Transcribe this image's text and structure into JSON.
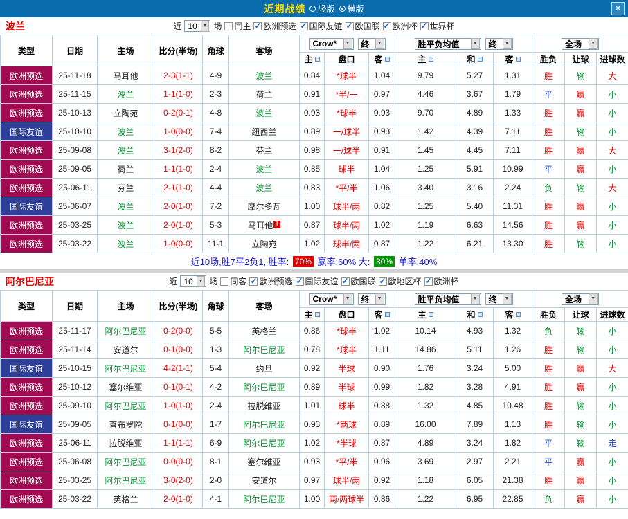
{
  "titlebar": {
    "title": "近期战绩",
    "radios": [
      {
        "label": "竖版",
        "selected": false
      },
      {
        "label": "横版",
        "selected": true
      }
    ]
  },
  "icons": {
    "close": "✕",
    "dropdown_arrow": "▼",
    "checkbox_check": "✓"
  },
  "colors": {
    "titlebar_bg": "#0A6BAD",
    "title_text": "#FFDD00",
    "type_european": "#A00A50",
    "type_friendly": "#2D3F99",
    "team_green": "#009933",
    "score_red": "#E60000",
    "handicap_red": "#E60000",
    "res_win": "#E60000",
    "res_draw": "#2244CC",
    "res_lose": "#009933",
    "badge_red": "#E10000",
    "badge_green": "#089408",
    "summary_text": "#1515CF",
    "grid_border": "#B9CEE2"
  },
  "table_header": {
    "cols": [
      "类型",
      "日期",
      "主场",
      "比分(半场)",
      "角球",
      "客场"
    ],
    "odds_group": {
      "bookmaker": "Crow*",
      "stage": "终"
    },
    "mean_group": {
      "label": "胜平负均值",
      "stage": "终"
    },
    "scope_group": {
      "label": "全场"
    },
    "sub": [
      "主",
      "盘口",
      "客",
      "主",
      "和",
      "客",
      "胜负",
      "让球",
      "进球数"
    ]
  },
  "sections": [
    {
      "team": "波兰",
      "filter": {
        "near": "近",
        "count": "10",
        "games": "场",
        "checks": [
          {
            "label": "同主",
            "checked": false
          },
          {
            "label": "欧洲预选",
            "checked": true
          },
          {
            "label": "国际友谊",
            "checked": true
          },
          {
            "label": "欧国联",
            "checked": true
          },
          {
            "label": "欧洲杯",
            "checked": true
          },
          {
            "label": "世界杯",
            "checked": true
          }
        ]
      },
      "rows": [
        {
          "type": "欧洲预选",
          "date": "25-11-18",
          "home": "马耳他",
          "score": "2-3(1-1)",
          "corners": "4-9",
          "away": "波兰",
          "odds": [
            "0.84",
            "*球半",
            "1.04"
          ],
          "means": [
            "9.79",
            "5.27",
            "1.31"
          ],
          "results": [
            "胜",
            "输",
            "大"
          ]
        },
        {
          "type": "欧洲预选",
          "date": "25-11-15",
          "home": "波兰",
          "score": "1-1(1-0)",
          "corners": "2-3",
          "away": "荷兰",
          "odds": [
            "0.91",
            "*半/一",
            "0.97"
          ],
          "means": [
            "4.46",
            "3.67",
            "1.79"
          ],
          "results": [
            "平",
            "赢",
            "小"
          ]
        },
        {
          "type": "欧洲预选",
          "date": "25-10-13",
          "home": "立陶宛",
          "score": "0-2(0-1)",
          "corners": "4-8",
          "away": "波兰",
          "odds": [
            "0.93",
            "*球半",
            "0.93"
          ],
          "means": [
            "9.70",
            "4.89",
            "1.33"
          ],
          "results": [
            "胜",
            "赢",
            "小"
          ]
        },
        {
          "type": "国际友谊",
          "date": "25-10-10",
          "home": "波兰",
          "score": "1-0(0-0)",
          "corners": "7-4",
          "away": "纽西兰",
          "odds": [
            "0.89",
            "一/球半",
            "0.93"
          ],
          "means": [
            "1.42",
            "4.39",
            "7.11"
          ],
          "results": [
            "胜",
            "输",
            "小"
          ]
        },
        {
          "type": "欧洲预选",
          "date": "25-09-08",
          "home": "波兰",
          "score": "3-1(2-0)",
          "corners": "8-2",
          "away": "芬兰",
          "odds": [
            "0.98",
            "一/球半",
            "0.91"
          ],
          "means": [
            "1.45",
            "4.45",
            "7.11"
          ],
          "results": [
            "胜",
            "赢",
            "大"
          ]
        },
        {
          "type": "欧洲预选",
          "date": "25-09-05",
          "home": "荷兰",
          "score": "1-1(1-0)",
          "corners": "2-4",
          "away": "波兰",
          "odds": [
            "0.85",
            "球半",
            "1.04"
          ],
          "means": [
            "1.25",
            "5.91",
            "10.99"
          ],
          "results": [
            "平",
            "赢",
            "小"
          ]
        },
        {
          "type": "欧洲预选",
          "date": "25-06-11",
          "home": "芬兰",
          "score": "2-1(1-0)",
          "corners": "4-4",
          "away": "波兰",
          "odds": [
            "0.83",
            "*平/半",
            "1.06"
          ],
          "means": [
            "3.40",
            "3.16",
            "2.24"
          ],
          "results": [
            "负",
            "输",
            "大"
          ]
        },
        {
          "type": "国际友谊",
          "date": "25-06-07",
          "home": "波兰",
          "score": "2-0(1-0)",
          "corners": "7-2",
          "away": "摩尔多瓦",
          "odds": [
            "1.00",
            "球半/两",
            "0.82"
          ],
          "means": [
            "1.25",
            "5.40",
            "11.31"
          ],
          "results": [
            "胜",
            "赢",
            "小"
          ]
        },
        {
          "type": "欧洲预选",
          "date": "25-03-25",
          "home": "波兰",
          "score": "2-0(1-0)",
          "corners": "5-3",
          "away": "马耳他",
          "away_badge": "1",
          "odds": [
            "0.87",
            "球半/两",
            "1.02"
          ],
          "means": [
            "1.19",
            "6.63",
            "14.56"
          ],
          "results": [
            "胜",
            "赢",
            "小"
          ]
        },
        {
          "type": "欧洲预选",
          "date": "25-03-22",
          "home": "波兰",
          "score": "1-0(0-0)",
          "corners": "11-1",
          "away": "立陶宛",
          "odds": [
            "1.02",
            "球半/两",
            "0.87"
          ],
          "means": [
            "1.22",
            "6.21",
            "13.30"
          ],
          "results": [
            "胜",
            "输",
            "小"
          ]
        }
      ],
      "summary": {
        "parts": [
          {
            "text": "近10场,胜7平2负1, 胜率: "
          },
          {
            "badge": "70%",
            "bg": "red"
          },
          {
            "text": " 赢率:60% 大: "
          },
          {
            "badge": "30%",
            "bg": "green"
          },
          {
            "text": " 单率:40%"
          }
        ]
      }
    },
    {
      "team": "阿尔巴尼亚",
      "filter": {
        "near": "近",
        "count": "10",
        "games": "场",
        "checks": [
          {
            "label": "同客",
            "checked": false
          },
          {
            "label": "欧洲预选",
            "checked": true
          },
          {
            "label": "国际友谊",
            "checked": true
          },
          {
            "label": "欧国联",
            "checked": true
          },
          {
            "label": "欧地区杯",
            "checked": true
          },
          {
            "label": "欧洲杯",
            "checked": true
          }
        ]
      },
      "rows": [
        {
          "type": "欧洲预选",
          "date": "25-11-17",
          "home": "阿尔巴尼亚",
          "score": "0-2(0-0)",
          "corners": "5-5",
          "away": "英格兰",
          "odds": [
            "0.86",
            "*球半",
            "1.02"
          ],
          "means": [
            "10.14",
            "4.93",
            "1.32"
          ],
          "results": [
            "负",
            "输",
            "小"
          ]
        },
        {
          "type": "欧洲预选",
          "date": "25-11-14",
          "home": "安道尔",
          "score": "0-1(0-0)",
          "corners": "1-3",
          "away": "阿尔巴尼亚",
          "odds": [
            "0.78",
            "*球半",
            "1.11"
          ],
          "means": [
            "14.86",
            "5.11",
            "1.26"
          ],
          "results": [
            "胜",
            "输",
            "小"
          ]
        },
        {
          "type": "国际友谊",
          "date": "25-10-15",
          "home": "阿尔巴尼亚",
          "score": "4-2(1-1)",
          "corners": "5-4",
          "away": "约旦",
          "odds": [
            "0.92",
            "半球",
            "0.90"
          ],
          "means": [
            "1.76",
            "3.24",
            "5.00"
          ],
          "results": [
            "胜",
            "赢",
            "大"
          ]
        },
        {
          "type": "欧洲预选",
          "date": "25-10-12",
          "home": "塞尔维亚",
          "score": "0-1(0-1)",
          "corners": "4-2",
          "away": "阿尔巴尼亚",
          "odds": [
            "0.89",
            "半球",
            "0.99"
          ],
          "means": [
            "1.82",
            "3.28",
            "4.91"
          ],
          "results": [
            "胜",
            "赢",
            "小"
          ]
        },
        {
          "type": "欧洲预选",
          "date": "25-09-10",
          "home": "阿尔巴尼亚",
          "score": "1-0(1-0)",
          "corners": "2-4",
          "away": "拉脱维亚",
          "odds": [
            "1.01",
            "球半",
            "0.88"
          ],
          "means": [
            "1.32",
            "4.85",
            "10.48"
          ],
          "results": [
            "胜",
            "输",
            "小"
          ]
        },
        {
          "type": "国际友谊",
          "date": "25-09-05",
          "home": "直布罗陀",
          "score": "0-1(0-0)",
          "corners": "1-7",
          "away": "阿尔巴尼亚",
          "odds": [
            "0.93",
            "*两球",
            "0.89"
          ],
          "means": [
            "16.00",
            "7.89",
            "1.13"
          ],
          "results": [
            "胜",
            "输",
            "小"
          ]
        },
        {
          "type": "欧洲预选",
          "date": "25-06-11",
          "home": "拉脱维亚",
          "score": "1-1(1-1)",
          "corners": "6-9",
          "away": "阿尔巴尼亚",
          "odds": [
            "1.02",
            "*半球",
            "0.87"
          ],
          "means": [
            "4.89",
            "3.24",
            "1.82"
          ],
          "results": [
            "平",
            "输",
            "走"
          ]
        },
        {
          "type": "欧洲预选",
          "date": "25-06-08",
          "home": "阿尔巴尼亚",
          "score": "0-0(0-0)",
          "corners": "8-1",
          "away": "塞尔维亚",
          "odds": [
            "0.93",
            "*平/半",
            "0.96"
          ],
          "means": [
            "3.69",
            "2.97",
            "2.21"
          ],
          "results": [
            "平",
            "赢",
            "小"
          ]
        },
        {
          "type": "欧洲预选",
          "date": "25-03-25",
          "home": "阿尔巴尼亚",
          "score": "3-0(2-0)",
          "corners": "2-0",
          "away": "安道尔",
          "odds": [
            "0.97",
            "球半/两",
            "0.92"
          ],
          "means": [
            "1.18",
            "6.05",
            "21.38"
          ],
          "results": [
            "胜",
            "赢",
            "小"
          ]
        },
        {
          "type": "欧洲预选",
          "date": "25-03-22",
          "home": "英格兰",
          "score": "2-0(1-0)",
          "corners": "4-1",
          "away": "阿尔巴尼亚",
          "odds": [
            "1.00",
            "两/两球半",
            "0.86"
          ],
          "means": [
            "1.22",
            "6.95",
            "22.85"
          ],
          "results": [
            "负",
            "赢",
            "小"
          ]
        }
      ],
      "summary": null
    }
  ]
}
